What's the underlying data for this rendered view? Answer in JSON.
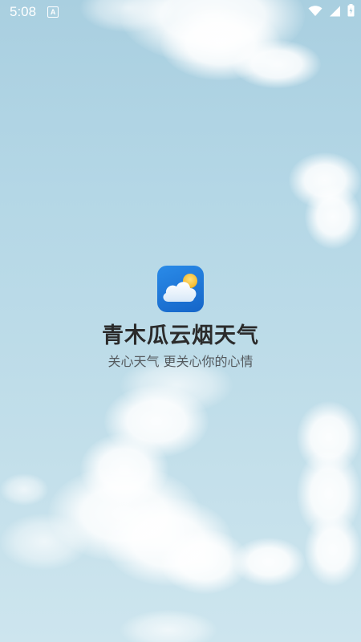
{
  "status_bar": {
    "time": "5:08",
    "notification_icon": "A",
    "icons": [
      "wifi-icon",
      "signal-icon",
      "battery-icon"
    ]
  },
  "splash": {
    "app_icon": "weather-cloud-sun-icon",
    "title": "青木瓜云烟天气",
    "slogan": "关心天气 更关心你的心情"
  },
  "colors": {
    "sky": "#b4d7e6",
    "icon_blue": "#1e78d8",
    "title_text": "#2b2b2b",
    "slogan_text": "#555a5e"
  }
}
